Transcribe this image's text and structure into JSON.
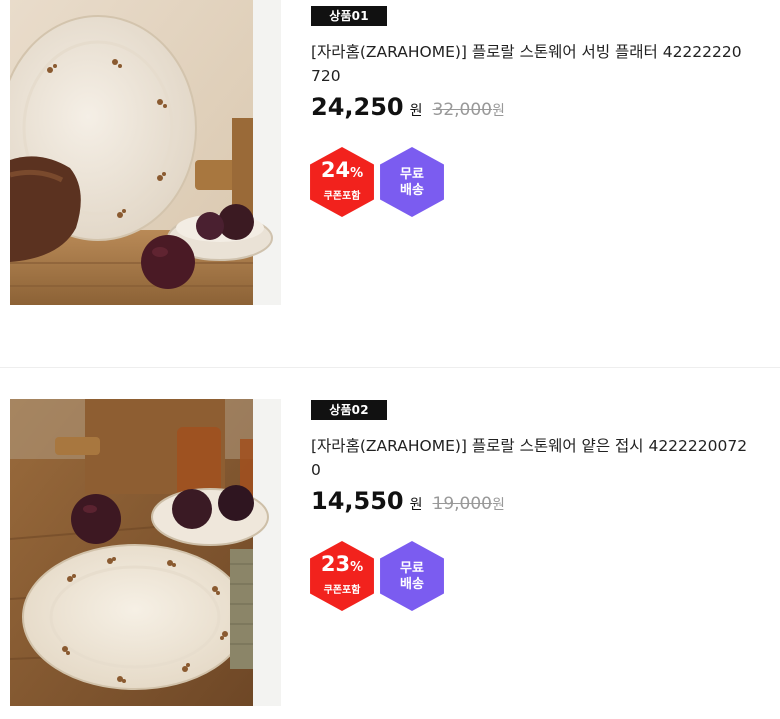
{
  "products": [
    {
      "tag": "상품01",
      "title": "[자라홈(ZARAHOME)] 플로랄 스톤웨어 서빙 플래터 42222220720",
      "price": "24,250",
      "price_unit": "원",
      "original_price": "32,000",
      "original_unit": "원",
      "discount": {
        "percent": "24",
        "percent_sign": "%",
        "label": "쿠폰포함"
      },
      "shipping": {
        "line1": "무료",
        "line2": "배송"
      },
      "image_alt": "floral-stoneware-serving-platter-photo"
    },
    {
      "tag": "상품02",
      "title": "[자라홈(ZARAHOME)] 플로랄 스톤웨어 얕은 접시 42222200720",
      "price": "14,550",
      "price_unit": "원",
      "original_price": "19,000",
      "original_unit": "원",
      "discount": {
        "percent": "23",
        "percent_sign": "%",
        "label": "쿠폰포함"
      },
      "shipping": {
        "line1": "무료",
        "line2": "배송"
      },
      "image_alt": "floral-stoneware-shallow-plate-photo"
    }
  ],
  "colors": {
    "tag_bg": "#111111",
    "discount_badge": "#f2221d",
    "shipping_badge": "#7b5cf0",
    "strike_price": "#999999"
  }
}
